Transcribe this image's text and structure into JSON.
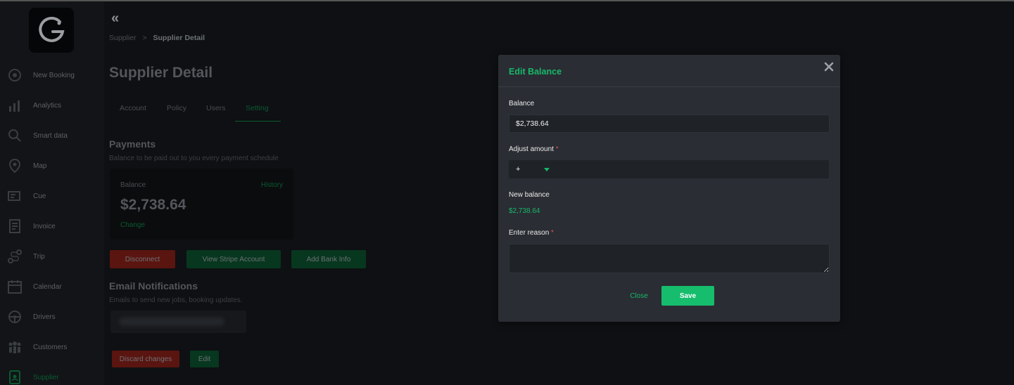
{
  "sidebar": {
    "items": [
      {
        "label": "New Booking",
        "icon": "new-booking-icon"
      },
      {
        "label": "Analytics",
        "icon": "analytics-icon"
      },
      {
        "label": "Smart data",
        "icon": "smart-data-icon"
      },
      {
        "label": "Map",
        "icon": "map-pin-icon"
      },
      {
        "label": "Cue",
        "icon": "cue-icon"
      },
      {
        "label": "Invoice",
        "icon": "invoice-icon"
      },
      {
        "label": "Trip",
        "icon": "trip-icon"
      },
      {
        "label": "Calendar",
        "icon": "calendar-icon"
      },
      {
        "label": "Drivers",
        "icon": "steering-wheel-icon"
      },
      {
        "label": "Customers",
        "icon": "customers-icon"
      },
      {
        "label": "Supplier",
        "icon": "supplier-icon",
        "active": true
      }
    ]
  },
  "breadcrumb": {
    "parent": "Supplier",
    "separator": ">",
    "current": "Supplier Detail"
  },
  "page": {
    "title": "Supplier Detail"
  },
  "tabs": [
    {
      "label": "Account"
    },
    {
      "label": "Policy"
    },
    {
      "label": "Users"
    },
    {
      "label": "Setting",
      "active": true
    }
  ],
  "payments": {
    "title": "Payments",
    "subtitle": "Balance to be paid out to you every payment schedule",
    "card": {
      "label": "Balance",
      "history": "History",
      "amount": "$2,738.64",
      "change": "Change"
    },
    "buttons": {
      "disconnect": "Disconnect",
      "view_stripe": "View Stripe Account",
      "add_bank": "Add Bank Info"
    }
  },
  "email_notifications": {
    "title": "Email Notifications",
    "subtitle": "Emails to send new jobs, booking updates."
  },
  "footer_buttons": {
    "discard": "Discard changes",
    "edit": "Edit"
  },
  "modal": {
    "title": "Edit Balance",
    "balance_label": "Balance",
    "balance_value": "$2,738.64",
    "adjust_label": "Adjust amount",
    "required_mark": "*",
    "adjust_sign": "+",
    "adjust_value": "",
    "new_balance_label": "New balance",
    "new_balance_value": "$2,738.64",
    "reason_label": "Enter reason",
    "reason_value": "",
    "close_label": "Close",
    "save_label": "Save"
  },
  "colors": {
    "accent": "#18b86a",
    "save_button": "#16bd6d",
    "required": "#e05252",
    "modal_bg": "#2a2d33",
    "page_bg": "#0e1013"
  }
}
